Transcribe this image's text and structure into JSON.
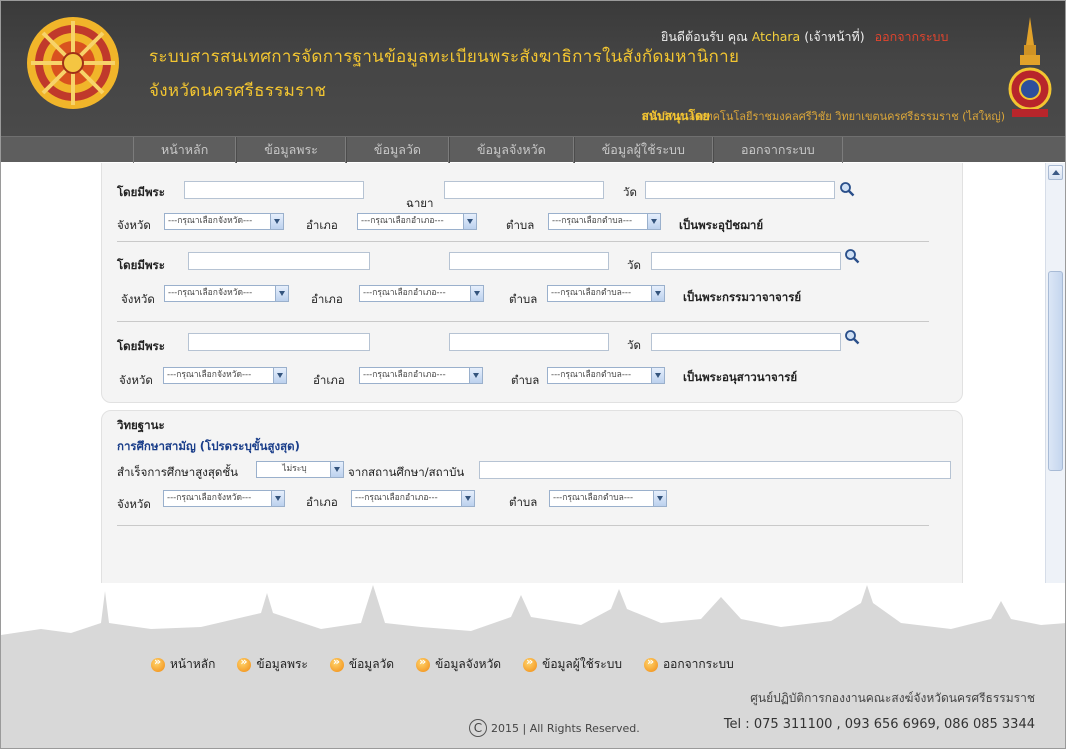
{
  "header": {
    "title_line1": "ระบบสารสนเทศการจัดการฐานข้อมูลทะเบียนพระสังฆาธิการในสังกัดมหานิกาย",
    "title_line2": "จังหวัดนครศรีธรรมราช",
    "welcome_prefix": "ยินดีต้อนรับ คุณ",
    "user_name": "Atchara",
    "user_role": "(เจ้าหน้าที่)",
    "logout": "ออกจากระบบ",
    "support_label": "สนับสนุนโดย",
    "support_org": "มหาวิทยาลัยเทคโนโลยีราชมงคลศรีวิชัย วิทยาเขตนครศรีธรรมราช (ไสใหญ่)"
  },
  "nav": {
    "items": [
      "หน้าหลัก",
      "ข้อมูลพระ",
      "ข้อมูลวัด",
      "ข้อมูลจังหวัด",
      "ข้อมูลผู้ใช้ระบบ",
      "ออกจากระบบ"
    ]
  },
  "form": {
    "labels": {
      "by_monk": "โดยมีพระ",
      "alias": "ฉายา",
      "temple": "วัด",
      "province": "จังหวัด",
      "district": "อำเภอ",
      "subdistrict": "ตำบล"
    },
    "selects": {
      "province": "---กรุณาเลือกจังหวัด---",
      "district": "---กรุณาเลือกอำเภอ---",
      "subdistrict": "---กรุณาเลือกตำบล---"
    },
    "roles": [
      "เป็นพระอุปัชฌาย์",
      "เป็นพระกรรมวาจาจารย์",
      "เป็นพระอนุสาวนาจารย์"
    ],
    "education": {
      "heading": "วิทยฐานะ",
      "subheading": "การศึกษาสามัญ (โปรดระบุขั้นสูงสุด)",
      "highest_label": "สำเร็จการศึกษาสูงสุดชั้น",
      "level_value": "ไม่ระบุ",
      "institution_label": "จากสถานศึกษา/สถาบัน"
    }
  },
  "footer": {
    "links": [
      "หน้าหลัก",
      "ข้อมูลพระ",
      "ข้อมูลวัด",
      "ข้อมูลจังหวัด",
      "ข้อมูลผู้ใช้ระบบ",
      "ออกจากระบบ"
    ],
    "org": "ศูนย์ปฏิบัติการกองงานคณะสงฆ์จังหวัดนครศรีธรรมราช",
    "tel": "Tel : 075 311100 , 093 656 6969, 086 085 3344",
    "copyright": "2015 | All Rights Reserved."
  },
  "colors": {
    "header_bg": "#454545",
    "title": "#f2c531",
    "logout": "#e2442d",
    "nav_bg": "#5e5e5e",
    "section_heading": "#1a3e8a"
  }
}
